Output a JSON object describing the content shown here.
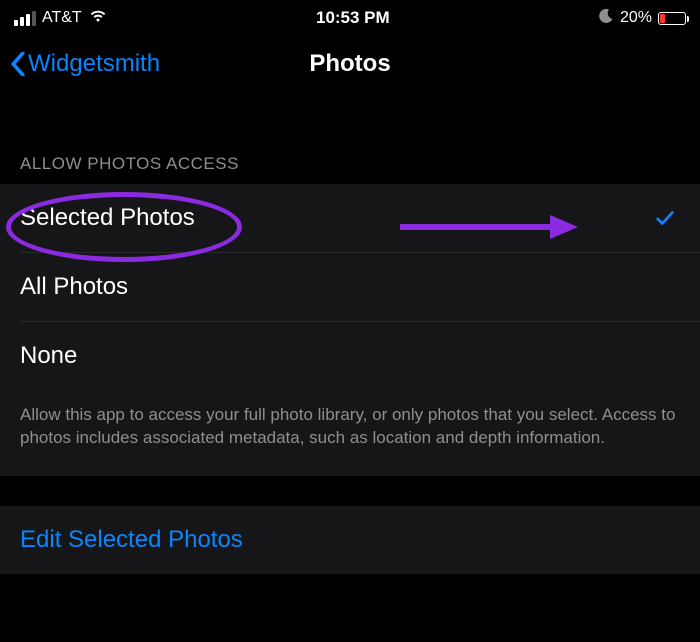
{
  "status": {
    "carrier": "AT&T",
    "time": "10:53 PM",
    "battery_pct": "20%"
  },
  "nav": {
    "back_label": "Widgetsmith",
    "title": "Photos"
  },
  "sections": {
    "header": "ALLOW PHOTOS ACCESS",
    "options": {
      "selected_photos": "Selected Photos",
      "all_photos": "All Photos",
      "none": "None"
    },
    "footer": "Allow this app to access your full photo library, or only photos that you select. Access to photos includes associated metadata, such as location and depth information."
  },
  "edit_link": "Edit Selected Photos",
  "annotation_colors": {
    "highlight": "#8a2be2"
  }
}
